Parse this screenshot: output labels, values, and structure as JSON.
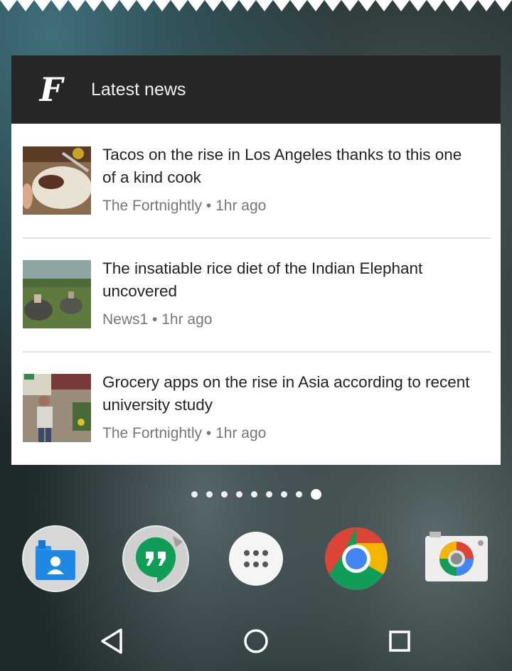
{
  "widget": {
    "logo_text": "F",
    "title": "Latest news",
    "items": [
      {
        "headline": "Tacos on the rise in Los Angeles thanks to this one of a kind cook",
        "source": "The Fortnightly",
        "time": "1hr ago"
      },
      {
        "headline": "The insatiable rice diet of the Indian Elephant uncovered",
        "source": "News1",
        "time": "1hr ago"
      },
      {
        "headline": "Grocery apps on the rise in Asia according to recent university study",
        "source": "The Fortnightly",
        "time": "1hr ago"
      }
    ]
  },
  "pager": {
    "page_count": 9,
    "active_page": 9
  },
  "dock": {
    "apps": [
      "contacts-icon",
      "hangouts-icon",
      "app-drawer-icon",
      "chrome-icon",
      "camera-icon"
    ]
  },
  "navbar": {
    "buttons": [
      "back-icon",
      "home-icon",
      "recents-icon"
    ]
  },
  "colors": {
    "header_bg": "#262626",
    "card_bg": "#ffffff",
    "headline": "#222222",
    "meta": "#777777"
  }
}
